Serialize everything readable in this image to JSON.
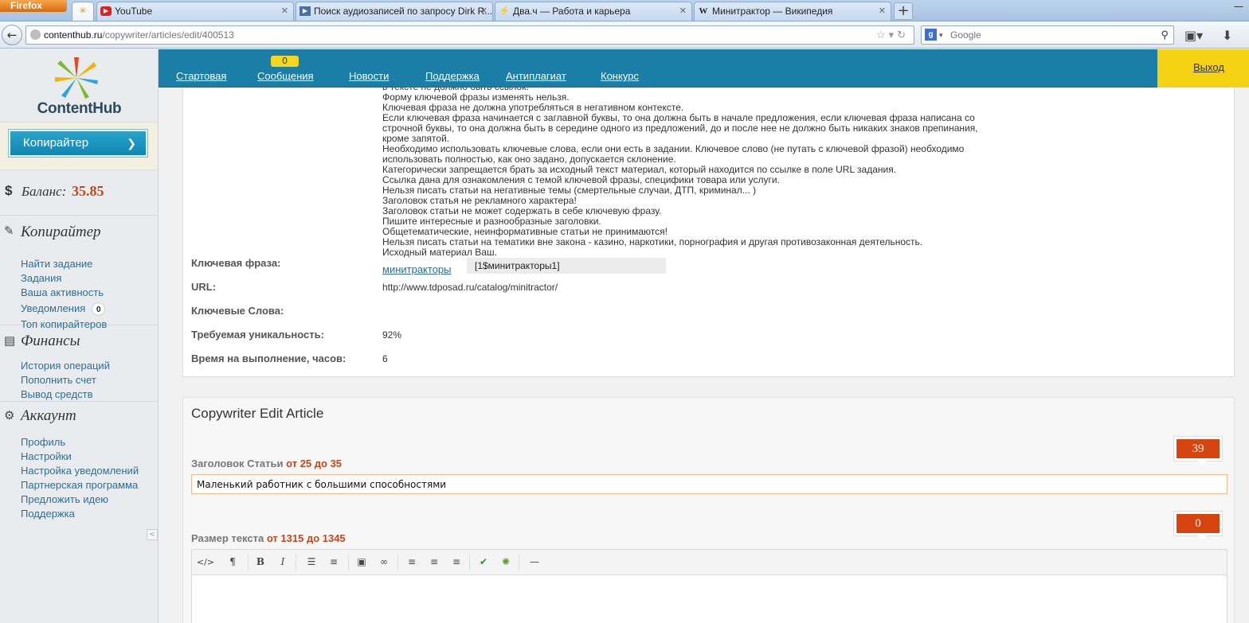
{
  "browser": {
    "menu_button": "Firefox",
    "tabs": [
      {
        "title": "",
        "icon": "contenthub-favicon",
        "active": true
      },
      {
        "title": "YouTube",
        "icon": "youtube-icon"
      },
      {
        "title": "Поиск аудиозаписей по запросу Dirk R...",
        "icon": "play-icon"
      },
      {
        "title": "Два.ч — Работа и карьера",
        "icon": "dvach-icon"
      },
      {
        "title": "Минитрактор — Википедия",
        "icon": "wikipedia-icon"
      }
    ],
    "url_host": "contenthub.ru",
    "url_path": "/copywriter/articles/edit/400513",
    "search_placeholder": "Google"
  },
  "sidebar": {
    "logo_text": "ContentHub",
    "role_button": "Копирайтер",
    "balance_label": "Баланс:",
    "balance_value": "35.85",
    "sections": [
      {
        "title": "Копирайтер",
        "icon": "edit-icon",
        "links": [
          "Найти задание",
          "Задания",
          "Ваша активность",
          "Уведомления",
          "Топ копирайтеров"
        ]
      },
      {
        "title": "Финансы",
        "icon": "wallet-icon",
        "links": [
          "История операций",
          "Пополнить счет",
          "Вывод средств"
        ]
      },
      {
        "title": "Аккаунт",
        "icon": "gear-icon",
        "links": [
          "Профиль",
          "Настройки",
          "Настройка уведомлений",
          "Партнерская программа",
          "Предложить идею",
          "Поддержка"
        ]
      }
    ],
    "notifications_count": "0"
  },
  "topnav": {
    "items": [
      "Стартовая",
      "Сообщения",
      "Новости",
      "Поддержка",
      "Антиплагиат",
      "Конкурс"
    ],
    "messages_badge": "0",
    "logout": "Выход"
  },
  "task": {
    "rules": [
      "в тексте не должно быть ссылок.",
      "Форму ключевой фразы изменять нельзя.",
      "Ключевая фраза не должна употребляться в негативном контексте.",
      "Если ключевая фраза начинается с заглавной буквы, то она должна быть в начале предложения, если ключевая фраза написана со",
      "строчной буквы, то она должна быть в середине одного из предложений, до и после нее не должно быть никаких знаков препинания,",
      "кроме запятой.",
      "Необходимо использовать ключевые слова, если они есть в задании. Ключевое слово (не путать с ключевой фразой) необходимо",
      "использовать полностью, как оно задано, допускается склонение.",
      "Категорически запрещается брать за исходный текст материал, который находится по ссылке в поле URL задания.",
      "Ссылка дана для ознакомления с темой ключевой фразы, специфики товара или услуги.",
      "Нельзя писать статьи на негативные темы (смертельные случаи, ДТП, криминал... )",
      "Заголовок статья не рекламного характера!",
      "Заголовок статьи не может содержать в себе ключевую фразу.",
      "Пишите интересные и разнообразные заголовки.",
      "Общетематические, неинформативные статьи не принимаются!",
      "Нельзя писать статьи на тематики вне закона - казино, наркотики, порнография и другая противозаконная деятельность.",
      "Исходный материал Ваш."
    ],
    "keyphrase_label": "Ключевая фраза:",
    "keyphrase_link": "минитракторы",
    "keyphrase_code": "[1$минитракторы1]",
    "url_label": "URL:",
    "url_value": "http://www.tdposad.ru/catalog/minitractor/",
    "keywords_label": "Ключевые Слова:",
    "keywords_value": "",
    "uniqueness_label": "Требуемая уникальность:",
    "uniqueness_value": "92%",
    "time_label": "Время на выполнение, часов:",
    "time_value": "6"
  },
  "edit": {
    "title": "Copywriter Edit Article",
    "headline_label": "Заголовок Статьи",
    "headline_range": "от 25 до 35",
    "headline_counter": "39",
    "headline_value": "Маленький работник с большими способностями",
    "size_label": "Размер текста",
    "size_range": "от 1315 до 1345",
    "size_counter": "0",
    "toolbar": [
      "html-icon",
      "paragraph-icon",
      "bold-icon",
      "italic-icon",
      "bullet-list-icon",
      "numbered-list-icon",
      "image-icon",
      "link-icon",
      "align-left-icon",
      "align-center-icon",
      "align-right-icon",
      "spellcheck-icon",
      "settings-icon",
      "horizontal-rule-icon"
    ]
  },
  "colors": {
    "brand_blue": "#1b7ea6",
    "accent_yellow": "#f4d213",
    "accent_orange": "#d6440f"
  }
}
